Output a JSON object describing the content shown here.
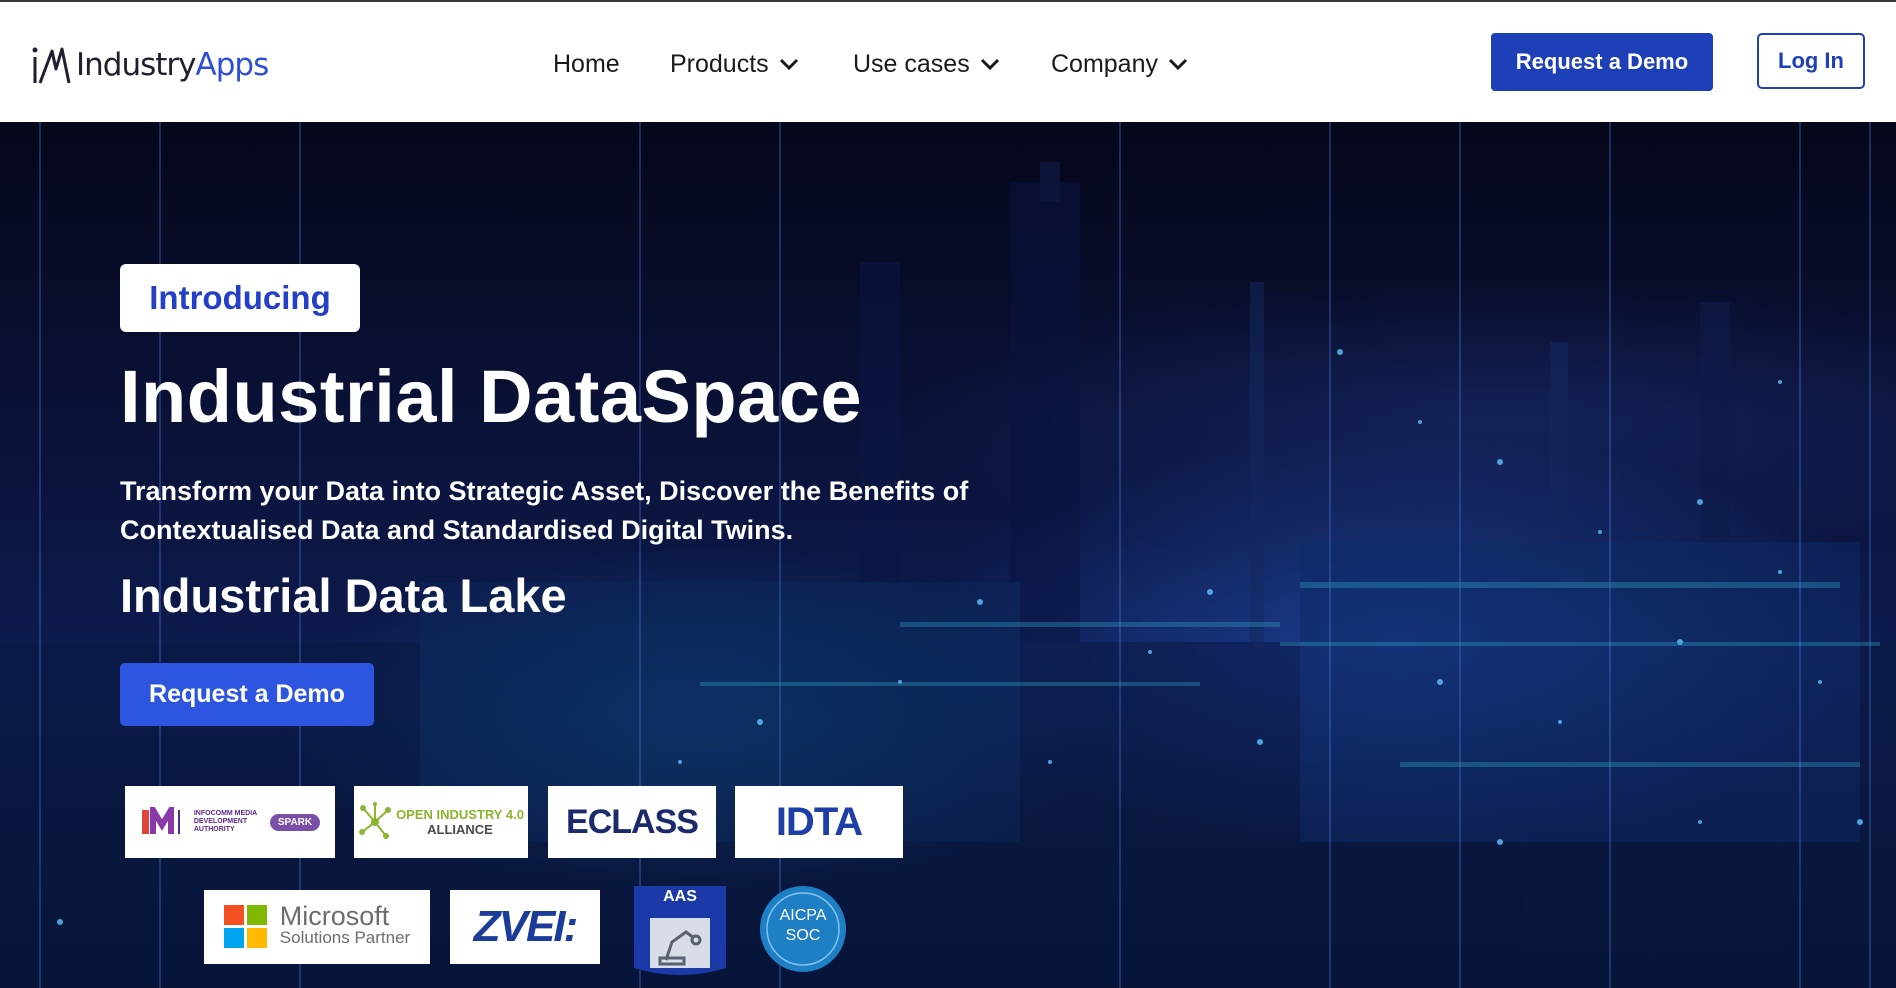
{
  "header": {
    "logo": {
      "brand_prefix": "Industry",
      "brand_suffix": "Apps"
    },
    "nav": [
      {
        "label": "Home",
        "has_dropdown": false
      },
      {
        "label": "Products",
        "has_dropdown": true
      },
      {
        "label": "Use cases",
        "has_dropdown": true
      },
      {
        "label": "Company",
        "has_dropdown": true
      }
    ],
    "request_demo_label": "Request a Demo",
    "login_label": "Log In"
  },
  "hero": {
    "tag": "Introducing",
    "title": "Industrial DataSpace",
    "subtitle": "Transform your Data into Strategic Asset, Discover the Benefits of Contextualised Data and Standardised Digital Twins.",
    "secondary_title": "Industrial Data Lake",
    "cta_label": "Request a Demo"
  },
  "partners": {
    "imda": {
      "text": "INFOCOMM MEDIA DEVELOPMENT AUTHORITY",
      "spark": "SPARK"
    },
    "oia": {
      "line1": "OPEN INDUSTRY 4.0",
      "line2": "ALLIANCE"
    },
    "eclass": "ECLASS",
    "idta": "IDTA",
    "microsoft": {
      "line1": "Microsoft",
      "line2": "Solutions Partner"
    },
    "zvei": "ZVEI:",
    "aas": "AAS",
    "aicpa": {
      "line1": "AICPA",
      "line2": "SOC"
    }
  },
  "colors": {
    "brand_blue": "#1d3fb8",
    "cta_blue": "#2d55e0",
    "logo_blue": "#2d4fd6"
  }
}
